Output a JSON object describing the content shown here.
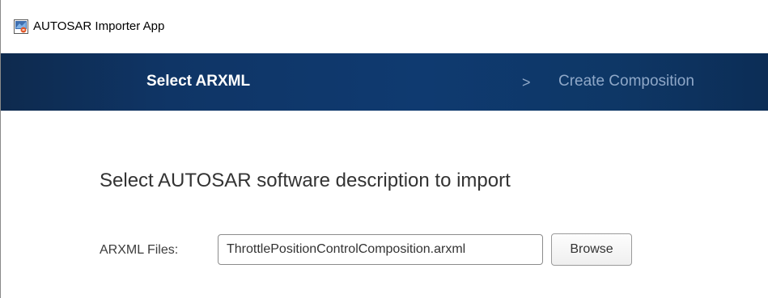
{
  "window": {
    "title": "AUTOSAR Importer App",
    "icon": "matlab-app-icon"
  },
  "steps": {
    "active": "Select ARXML",
    "separator": ">",
    "next": "Create Composition"
  },
  "main": {
    "heading": "Select AUTOSAR software description to import",
    "file_label": "ARXML Files:",
    "file_value": "ThrottlePositionControlComposition.arxml",
    "browse_label": "Browse"
  },
  "colors": {
    "stepbar": "#0f3a70",
    "active_step_text": "#ffffff",
    "inactive_step_text": "#8fa8c8"
  }
}
